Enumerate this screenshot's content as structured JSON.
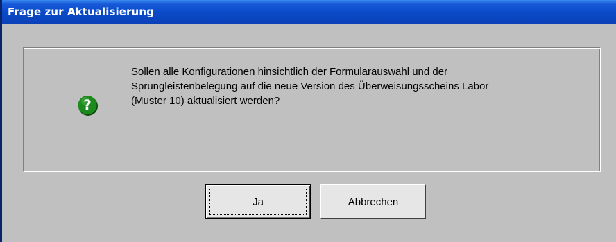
{
  "window": {
    "title": "Frage zur Aktualisierung"
  },
  "message": {
    "icon": "question-icon",
    "line1": "Sollen alle Konfigurationen hinsichtlich der Formularauswahl und der",
    "line2": "Sprungleistenbelegung auf die neue Version des Überweisungsscheins Labor",
    "line3": "(Muster 10) aktualisiert werden?"
  },
  "buttons": {
    "yes_label": "Ja",
    "cancel_label": "Abbrechen"
  },
  "colors": {
    "titlebar": "#0a4ac8",
    "dialog_face": "#c0c0c0",
    "icon_green": "#1e8a1e"
  }
}
